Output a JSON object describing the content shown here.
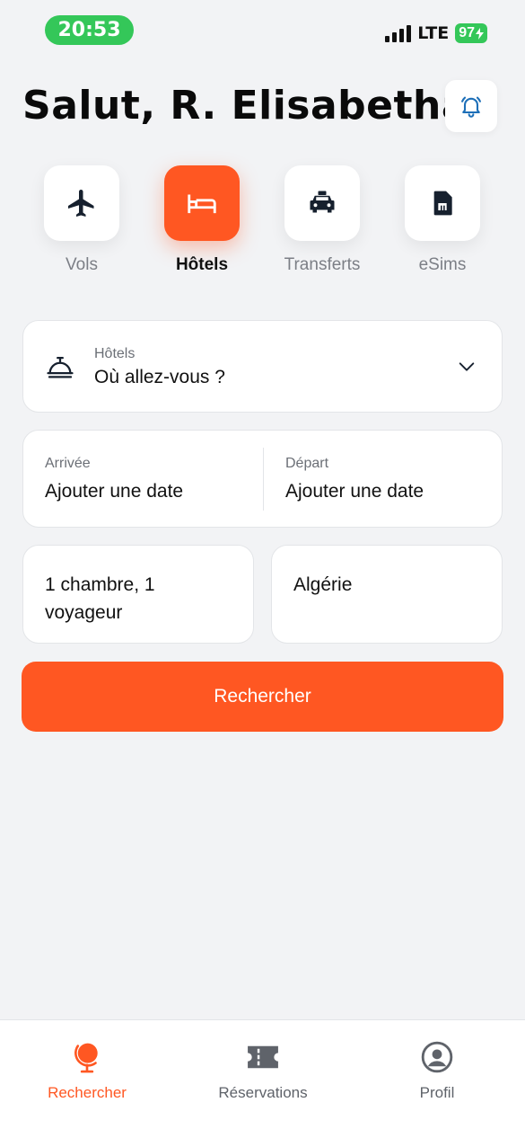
{
  "status_bar": {
    "time": "20:53",
    "network": "LTE",
    "battery": "97"
  },
  "header": {
    "greeting": "Salut, R. Elisabetha"
  },
  "categories": [
    {
      "label": "Vols",
      "icon": "airplane-icon",
      "active": false
    },
    {
      "label": "Hôtels",
      "icon": "bed-icon",
      "active": true
    },
    {
      "label": "Transferts",
      "icon": "taxi-icon",
      "active": false
    },
    {
      "label": "eSims",
      "icon": "sim-card-icon",
      "active": false
    }
  ],
  "form": {
    "destination": {
      "label": "Hôtels",
      "placeholder": "Où allez-vous ?"
    },
    "checkin": {
      "label": "Arrivée",
      "value": "Ajouter une date"
    },
    "checkout": {
      "label": "Départ",
      "value": "Ajouter une date"
    },
    "guests": "1 chambre, 1 voyageur",
    "country": "Algérie",
    "search_label": "Rechercher"
  },
  "bottom_nav": [
    {
      "label": "Rechercher",
      "icon": "globe-icon",
      "active": true
    },
    {
      "label": "Réservations",
      "icon": "ticket-icon",
      "active": false
    },
    {
      "label": "Profil",
      "icon": "profile-icon",
      "active": false
    }
  ],
  "colors": {
    "accent": "#ff5722",
    "background": "#f2f3f5",
    "status_green": "#34c759"
  }
}
